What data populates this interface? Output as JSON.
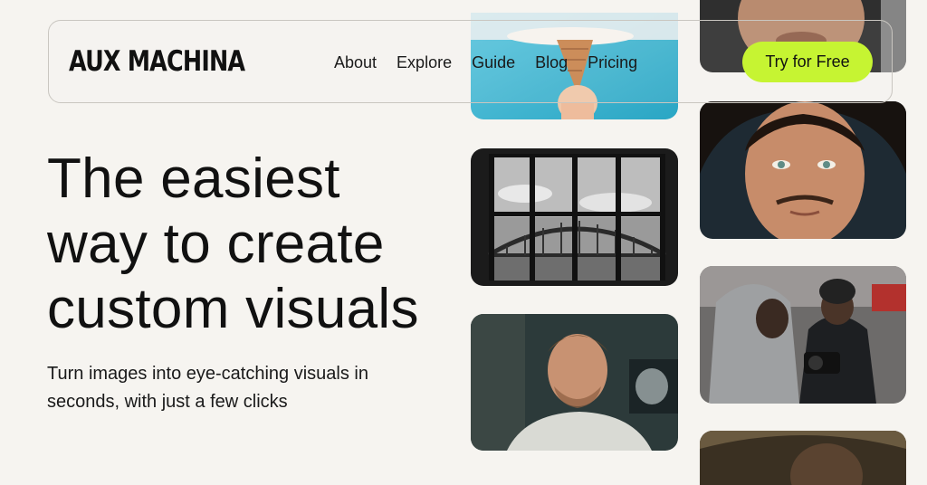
{
  "brand": {
    "logo_text": "AUX MACHINA"
  },
  "nav": {
    "links": [
      "About",
      "Explore",
      "Guide",
      "Blog",
      "Pricing"
    ],
    "cta_label": "Try for Free"
  },
  "hero": {
    "title_lines": [
      "The easiest",
      "way to create",
      "custom visuals"
    ],
    "subtitle_lines": [
      "Turn images into eye-catching visuals in",
      "seconds, with just a few clicks"
    ]
  },
  "colors": {
    "page_background": "#f6f4f0",
    "cta_background": "#c6f432",
    "text": "#111111"
  },
  "gallery": {
    "tiles": [
      "ice-cream-cone-image",
      "bridge-through-window-image",
      "man-portrait-image",
      "face-closeup-image",
      "freckled-man-portrait-image",
      "photographers-street-image",
      "dramatic-portrait-image"
    ]
  }
}
